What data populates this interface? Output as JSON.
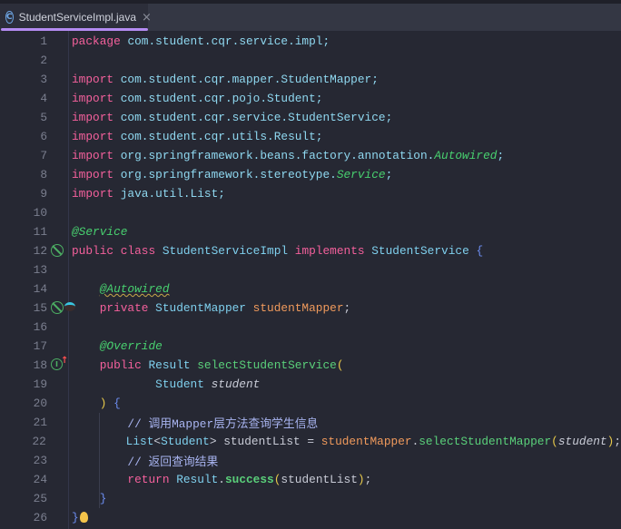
{
  "tab": {
    "label": "StudentServiceImpl.java",
    "icon": "class-icon",
    "icon_glyph": "C",
    "close": "×"
  },
  "colors": {
    "background": "#262833",
    "keyword": "#f4609c",
    "annotation": "#48d06f",
    "type": "#7fd0ee",
    "field": "#f09a5c",
    "comment": "#a8b4f0",
    "active_tab_underline": "#b48cf2"
  },
  "lines": [
    {
      "n": "1",
      "t": [
        [
          "package",
          "kw"
        ],
        [
          " com.student.cqr.service.impl;",
          "pk"
        ]
      ]
    },
    {
      "n": "2",
      "t": []
    },
    {
      "n": "3",
      "t": [
        [
          "import",
          "kw"
        ],
        [
          " com.student.cqr.mapper.StudentMapper;",
          "pk"
        ]
      ]
    },
    {
      "n": "4",
      "t": [
        [
          "import",
          "kw"
        ],
        [
          " com.student.cqr.pojo.Student;",
          "pk"
        ]
      ]
    },
    {
      "n": "5",
      "t": [
        [
          "import",
          "kw"
        ],
        [
          " com.student.cqr.service.StudentService;",
          "pk"
        ]
      ]
    },
    {
      "n": "6",
      "t": [
        [
          "import",
          "kw"
        ],
        [
          " com.student.cqr.utils.Result;",
          "pk"
        ]
      ]
    },
    {
      "n": "7",
      "t": [
        [
          "import",
          "kw"
        ],
        [
          " org.springframework.beans.factory.annotation.",
          "pk"
        ],
        [
          "Autowired",
          "an"
        ],
        [
          ";",
          "pk"
        ]
      ]
    },
    {
      "n": "8",
      "t": [
        [
          "import",
          "kw"
        ],
        [
          " org.springframework.stereotype.",
          "pk"
        ],
        [
          "Service",
          "an"
        ],
        [
          ";",
          "pk"
        ]
      ]
    },
    {
      "n": "9",
      "t": [
        [
          "import",
          "kw"
        ],
        [
          " java.util.List;",
          "pk"
        ]
      ]
    },
    {
      "n": "10",
      "t": []
    },
    {
      "n": "11",
      "t": [
        [
          "@Service",
          "an"
        ]
      ]
    },
    {
      "n": "12",
      "g": "no-bean",
      "t": [
        [
          "public class ",
          "kw"
        ],
        [
          "StudentServiceImpl ",
          "ty"
        ],
        [
          "implements ",
          "kw"
        ],
        [
          "StudentService ",
          "ty"
        ],
        [
          "{",
          "br2"
        ]
      ]
    },
    {
      "n": "13",
      "t": []
    },
    {
      "n": "14",
      "t": [
        [
          "    ",
          ""
        ],
        [
          "@Autowired",
          "an wavy"
        ]
      ]
    },
    {
      "n": "15",
      "g": "no-bean-inject",
      "t": [
        [
          "    private ",
          "kw"
        ],
        [
          "StudentMapper ",
          "ty"
        ],
        [
          "studentMapper",
          "fd"
        ],
        [
          ";",
          ""
        ]
      ]
    },
    {
      "n": "16",
      "t": []
    },
    {
      "n": "17",
      "t": [
        [
          "    ",
          ""
        ],
        [
          "@Override",
          "an"
        ]
      ]
    },
    {
      "n": "18",
      "g": "implements",
      "t": [
        [
          "    public ",
          "kw"
        ],
        [
          "Result ",
          "ty"
        ],
        [
          "selectStudentService",
          "fn"
        ],
        [
          "(",
          "br"
        ]
      ]
    },
    {
      "n": "19",
      "t": [
        [
          "            Student ",
          "ty"
        ],
        [
          "student",
          "it"
        ]
      ]
    },
    {
      "n": "20",
      "t": [
        [
          "    ",
          ""
        ],
        [
          ")",
          "br"
        ],
        [
          " {",
          "br2"
        ]
      ]
    },
    {
      "n": "21",
      "t": [
        [
          "        // 调用Mapper层方法查询学生信息",
          "cm"
        ]
      ]
    },
    {
      "n": "22",
      "t": [
        [
          "        List",
          "ty"
        ],
        [
          "<",
          ""
        ],
        [
          "Student",
          "ty"
        ],
        [
          "> studentList = ",
          ""
        ],
        [
          "studentMapper",
          "fd"
        ],
        [
          ".",
          ""
        ],
        [
          "selectStudentMapper",
          "fn"
        ],
        [
          "(",
          "br"
        ],
        [
          "student",
          "it"
        ],
        [
          ")",
          "br"
        ],
        [
          ";",
          ""
        ]
      ]
    },
    {
      "n": "23",
      "t": [
        [
          "        // 返回查询结果",
          "cm"
        ]
      ]
    },
    {
      "n": "24",
      "t": [
        [
          "        return ",
          "kw"
        ],
        [
          "Result",
          "ty"
        ],
        [
          ".",
          ""
        ],
        [
          "success",
          "fn bold"
        ],
        [
          "(",
          "br"
        ],
        [
          "studentList",
          ""
        ],
        [
          ")",
          "br"
        ],
        [
          ";",
          ""
        ]
      ]
    },
    {
      "n": "25",
      "t": [
        [
          "    }",
          "br2"
        ]
      ]
    },
    {
      "n": "26",
      "t": [
        [
          "}",
          "br2"
        ]
      ],
      "bulb": true
    }
  ]
}
